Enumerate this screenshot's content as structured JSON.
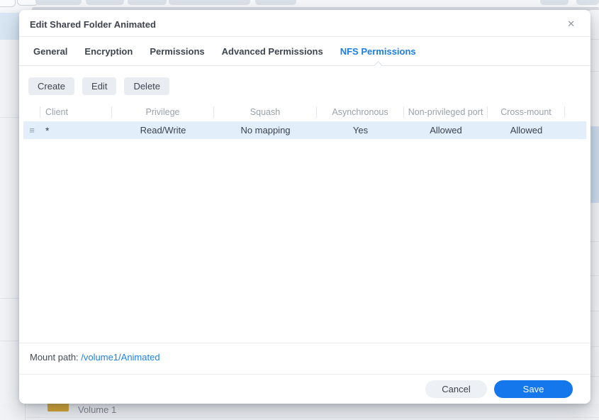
{
  "colors": {
    "accent_blue": "#1577ec",
    "active_tab_blue": "#1a7ee6",
    "link_blue": "#1e82e8",
    "selected_row_bg": "#e2eefa",
    "folder_icon_yellow": "#d7a52c"
  },
  "background": {
    "volume_label": "Volume 1"
  },
  "dialog": {
    "title": "Edit Shared Folder Animated",
    "close_icon": "✕",
    "tabs": [
      {
        "label": "General"
      },
      {
        "label": "Encryption"
      },
      {
        "label": "Permissions"
      },
      {
        "label": "Advanced Permissions"
      },
      {
        "label": "NFS Permissions"
      }
    ],
    "toolbar": {
      "create_label": "Create",
      "edit_label": "Edit",
      "delete_label": "Delete"
    },
    "table": {
      "columns": [
        "Client",
        "Privilege",
        "Squash",
        "Asynchronous",
        "Non-privileged port",
        "Cross-mount"
      ],
      "rows": [
        {
          "drag_icon": "≡",
          "client": "*",
          "privilege": "Read/Write",
          "squash": "No mapping",
          "asynchronous": "Yes",
          "non_privileged_port": "Allowed",
          "cross_mount": "Allowed"
        }
      ]
    },
    "mount_path": {
      "label": "Mount path: ",
      "value": "/volume1/Animated"
    },
    "footer": {
      "cancel_label": "Cancel",
      "save_label": "Save"
    }
  }
}
